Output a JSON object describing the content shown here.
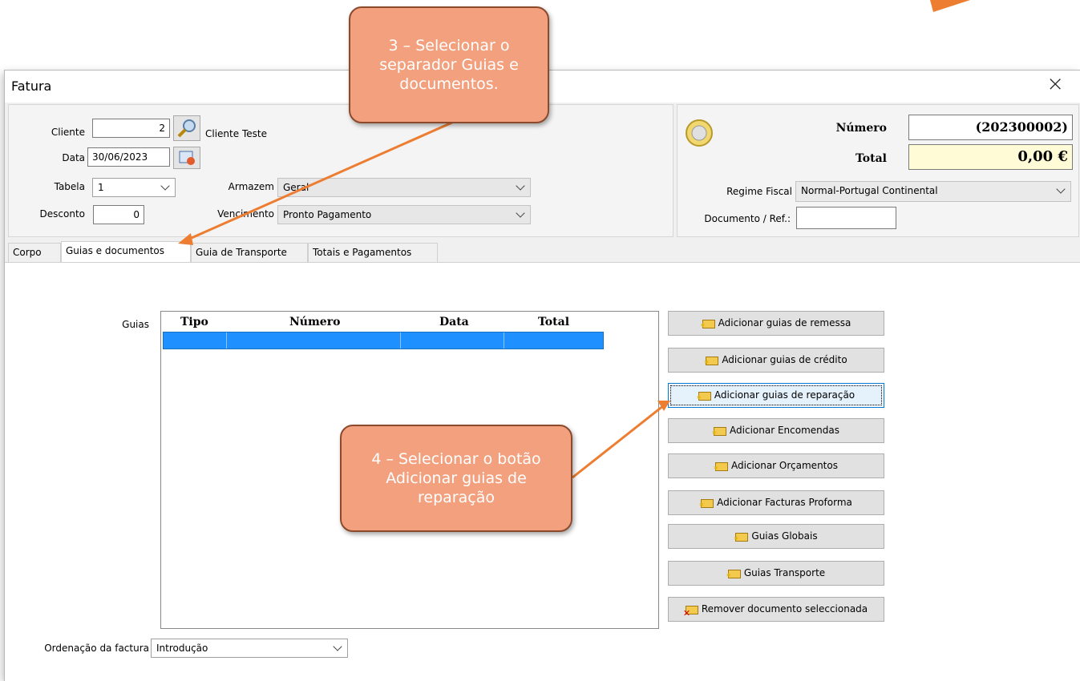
{
  "window": {
    "title": "Fatura"
  },
  "header": {
    "cliente_label": "Cliente",
    "cliente_value": "2",
    "cliente_name": "Cliente Teste",
    "data_label": "Data",
    "data_value": "30/06/2023",
    "tabela_label": "Tabela",
    "tabela_value": "1",
    "armazem_label": "Armazem",
    "armazem_value": "Geral",
    "desconto_label": "Desconto",
    "desconto_value": "0",
    "vencimento_label": "Vencimento",
    "vencimento_value": "Pronto Pagamento"
  },
  "summary": {
    "numero_label": "Número",
    "numero_value": "(202300002)",
    "total_label": "Total",
    "total_value": "0,00 €",
    "regime_label": "Regime Fiscal",
    "regime_value": "Normal-Portugal Continental",
    "docref_label": "Documento / Ref.:",
    "docref_value": ""
  },
  "tabs": [
    {
      "label": "Corpo"
    },
    {
      "label": "Guias e documentos"
    },
    {
      "label": "Guia de Transporte"
    },
    {
      "label": "Totais e Pagamentos"
    }
  ],
  "guias": {
    "label": "Guias",
    "columns": [
      "Tipo",
      "Número",
      "Data",
      "Total"
    ]
  },
  "buttons": [
    {
      "label": "Adicionar guias de remessa"
    },
    {
      "label": "Adicionar guias de crédito"
    },
    {
      "label": "Adicionar guias de reparação"
    },
    {
      "label": "Adicionar Encomendas"
    },
    {
      "label": "Adicionar Orçamentos"
    },
    {
      "label": "Adicionar Facturas Proforma"
    },
    {
      "label": "Guias Globais"
    },
    {
      "label": "Guias Transporte"
    },
    {
      "label": "Remover documento seleccionada"
    }
  ],
  "ordenacao": {
    "label": "Ordenação da factura",
    "value": "Introdução"
  },
  "callouts": {
    "step3": "3 – Selecionar o separador Guias e documentos.",
    "step4": "4 – Selecionar o botão Adicionar guias de reparação"
  },
  "colors": {
    "accent": "#f2a07e",
    "selection": "#1e90ff",
    "total_bg": "#fffbd6"
  }
}
